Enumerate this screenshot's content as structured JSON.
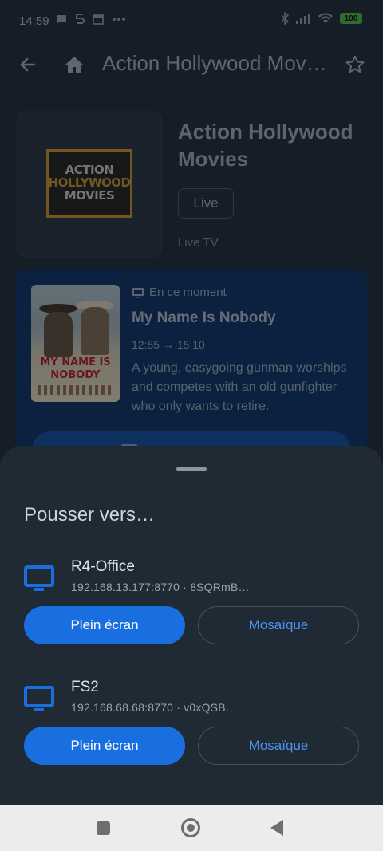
{
  "status_bar": {
    "time": "14:59",
    "left_icons": [
      "message-icon",
      "lettre-icon",
      "calendar-icon",
      "more-dots-icon"
    ],
    "right_icons": [
      "bluetooth-icon",
      "signal-icon",
      "wifi-icon"
    ],
    "battery": "100"
  },
  "toolbar": {
    "title": "Action Hollywood Movies",
    "back_icon": "arrow-left-icon",
    "home_icon": "home-icon",
    "favorite_icon": "star-outline-icon"
  },
  "channel": {
    "logo_line1": "ACTION",
    "logo_line2": "HOLLYWOOD",
    "logo_line3": "MOVIES",
    "title": "Action Hollywood Movies",
    "live_label": "Live",
    "subtitle": "Live TV"
  },
  "now_playing": {
    "label": "En ce moment",
    "title": "My Name Is Nobody",
    "time": "12:55 → 15:10",
    "description": "A young, easygoing gunman worships and competes with an old gunfighter who only wants to retire.",
    "poster_text": "MY NAME IS NOBODY"
  },
  "sheet": {
    "title": "Pousser vers…",
    "devices": [
      {
        "name": "R4-Office",
        "address": "192.168.13.177:8770 · 8SQRmB…",
        "full_label": "Plein écran",
        "mosaic_label": "Mosaïque"
      },
      {
        "name": "FS2",
        "address": "192.168.68.68:8770 · v0xQSB…",
        "full_label": "Plein écran",
        "mosaic_label": "Mosaïque"
      }
    ]
  },
  "colors": {
    "accent": "#1a6fe0",
    "sheet_bg": "#1f2a34",
    "now_card_bg": "#0d2f5f"
  }
}
